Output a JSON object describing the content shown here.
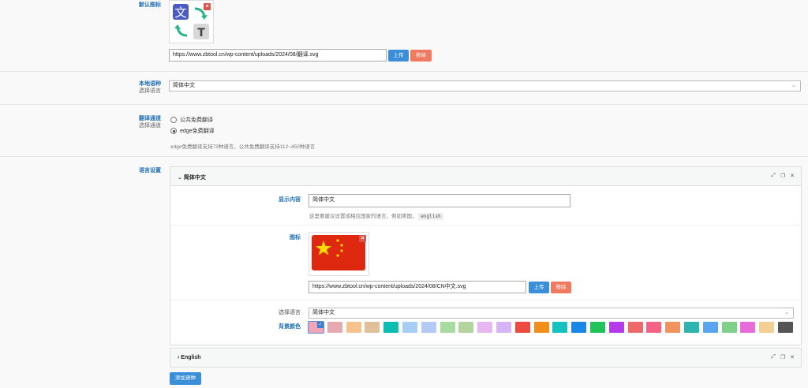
{
  "default_icon": {
    "label": "默认图标",
    "url": "https://www.zbtool.cn/wp-content/uploads/2024/08/翻译.svg",
    "upload_label": "上传",
    "remove_label": "移除",
    "icon_glyph_wen": "文",
    "icon_glyph_t": "T",
    "remove_glyph": "×"
  },
  "local_language": {
    "label": "本地语种",
    "sublabel": "选择语言",
    "value": "简体中文"
  },
  "translation_channel": {
    "label": "翻译通道",
    "sublabel": "选择通道",
    "options": [
      "公共免费翻译",
      "edge免费翻译"
    ],
    "selected_index": 1,
    "help": "edge免费翻译支持73种语言，公共免费翻译支持112~450种语言"
  },
  "language_settings": {
    "label": "语言设置",
    "panels": [
      {
        "title": "简体中文",
        "expanded": true,
        "display_label": "显示内容",
        "display_value": "简体中文",
        "display_help": "这里要建议设置成相应国家的语言，例如美国，",
        "display_help_code": "english",
        "icon_label": "图标",
        "icon_url": "https://www.zbtool.cn/wp-content/uploads/2024/08/CN中文.svg",
        "upload_label": "上传",
        "remove_label": "移除",
        "select_language_label": "选择语言",
        "select_language_value": "简体中文",
        "bg_color_label": "背景颜色"
      },
      {
        "title": "English",
        "expanded": false
      }
    ],
    "add_button": "添加语种",
    "swatches": [
      "#f0a6b9",
      "#e5a9b1",
      "#f6c28e",
      "#dfc09a",
      "#0dbdb2",
      "#a8cef5",
      "#b5c9f5",
      "#a8dba0",
      "#b3d39f",
      "#e8b6f2",
      "#d7b4f5",
      "#ef4a3f",
      "#f0901a",
      "#15c2bd",
      "#1a86e8",
      "#20c25a",
      "#b53bea",
      "#ee6a6a",
      "#f46383",
      "#f2935d",
      "#2bb7b0",
      "#5aa5f2",
      "#7fd089",
      "#e86bd8",
      "#f3cf95",
      "#555555"
    ],
    "selected_swatch": 0,
    "check_glyph": "✓",
    "tool_icons": [
      "⤢",
      "❐",
      "✕"
    ]
  },
  "colors": {
    "accent": "#1f6fb5",
    "upload": "#3b8fd9",
    "remove": "#f07a5f"
  }
}
